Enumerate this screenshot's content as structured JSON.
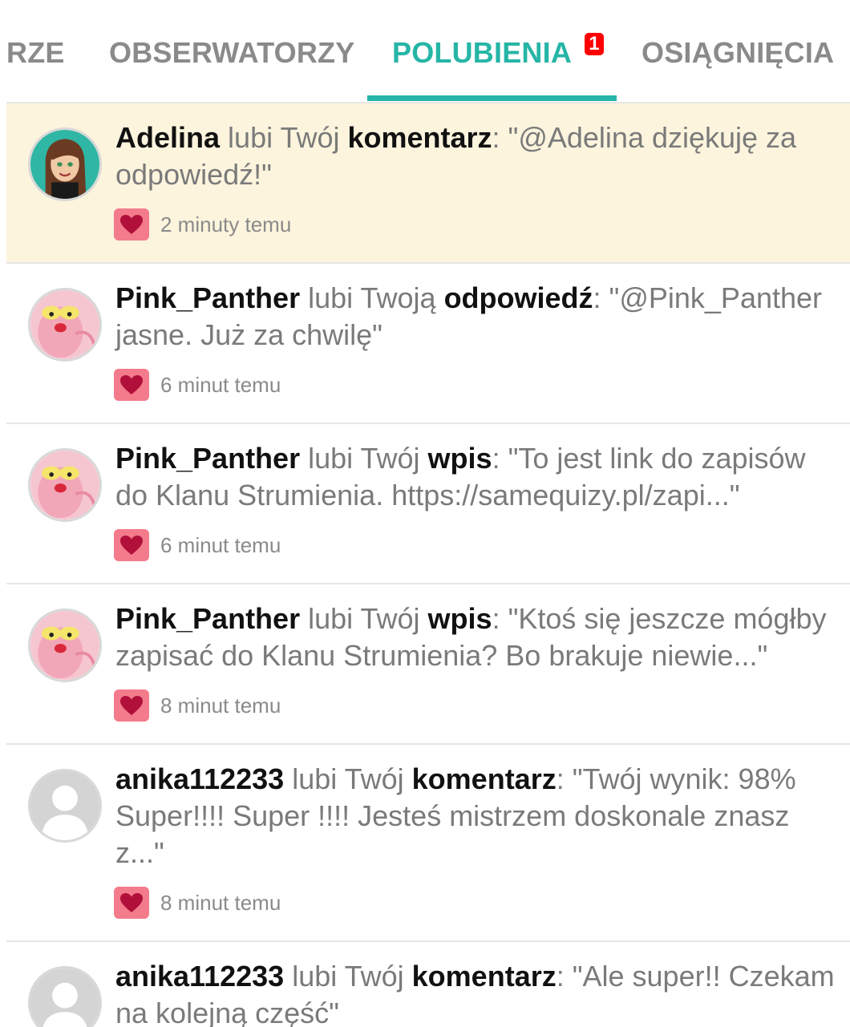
{
  "tabs": [
    {
      "label": "RZE",
      "active": false
    },
    {
      "label": "OBSERWATORZY",
      "active": false
    },
    {
      "label": "POLUBIENIA",
      "active": true,
      "badge": "1"
    },
    {
      "label": "OSIĄGNIĘCIA",
      "active": false
    }
  ],
  "colors": {
    "accent": "#26b5a6",
    "highlight": "#fcf4dd",
    "heart_bg": "#f37b8c",
    "heart": "#b0103a",
    "badge": "#ff0000"
  },
  "items": [
    {
      "user": "Adelina",
      "verb": "lubi Twój",
      "object": "komentarz",
      "quote": ": \"@Adelina dziękuję za odpowiedź!\"",
      "time": "2 minuty temu",
      "avatar": "bitmoji-avatar",
      "highlight": true
    },
    {
      "user": "Pink_Panther",
      "verb": "lubi Twoją",
      "object": "odpowiedź",
      "quote": ": \"@Pink_Panther jasne. Już za chwilę\"",
      "time": "6 minut temu",
      "avatar": "pink-panther-avatar"
    },
    {
      "user": "Pink_Panther",
      "verb": "lubi Twój",
      "object": "wpis",
      "quote": ": \"To jest link do zapisów do Klanu Strumienia. https://samequizy.pl/zapi...\"",
      "time": "6 minut temu",
      "avatar": "pink-panther-avatar"
    },
    {
      "user": "Pink_Panther",
      "verb": "lubi Twój",
      "object": "wpis",
      "quote": ": \"Ktoś się jeszcze mógłby zapisać do Klanu Strumienia? Bo brakuje niewie...\"",
      "time": "8 minut temu",
      "avatar": "pink-panther-avatar"
    },
    {
      "user": "anika112233",
      "verb": "lubi Twój",
      "object": "komentarz",
      "quote": ": \"Twój wynik: 98% Super!!!! Super !!!! Jesteś mistrzem doskonale znasz z...\"",
      "time": "8 minut temu",
      "avatar": "default-avatar"
    },
    {
      "user": "anika112233",
      "verb": "lubi Twój",
      "object": "komentarz",
      "quote": ": \"Ale super!! Czekam na kolejną część\"",
      "time": "",
      "avatar": "default-avatar"
    }
  ]
}
